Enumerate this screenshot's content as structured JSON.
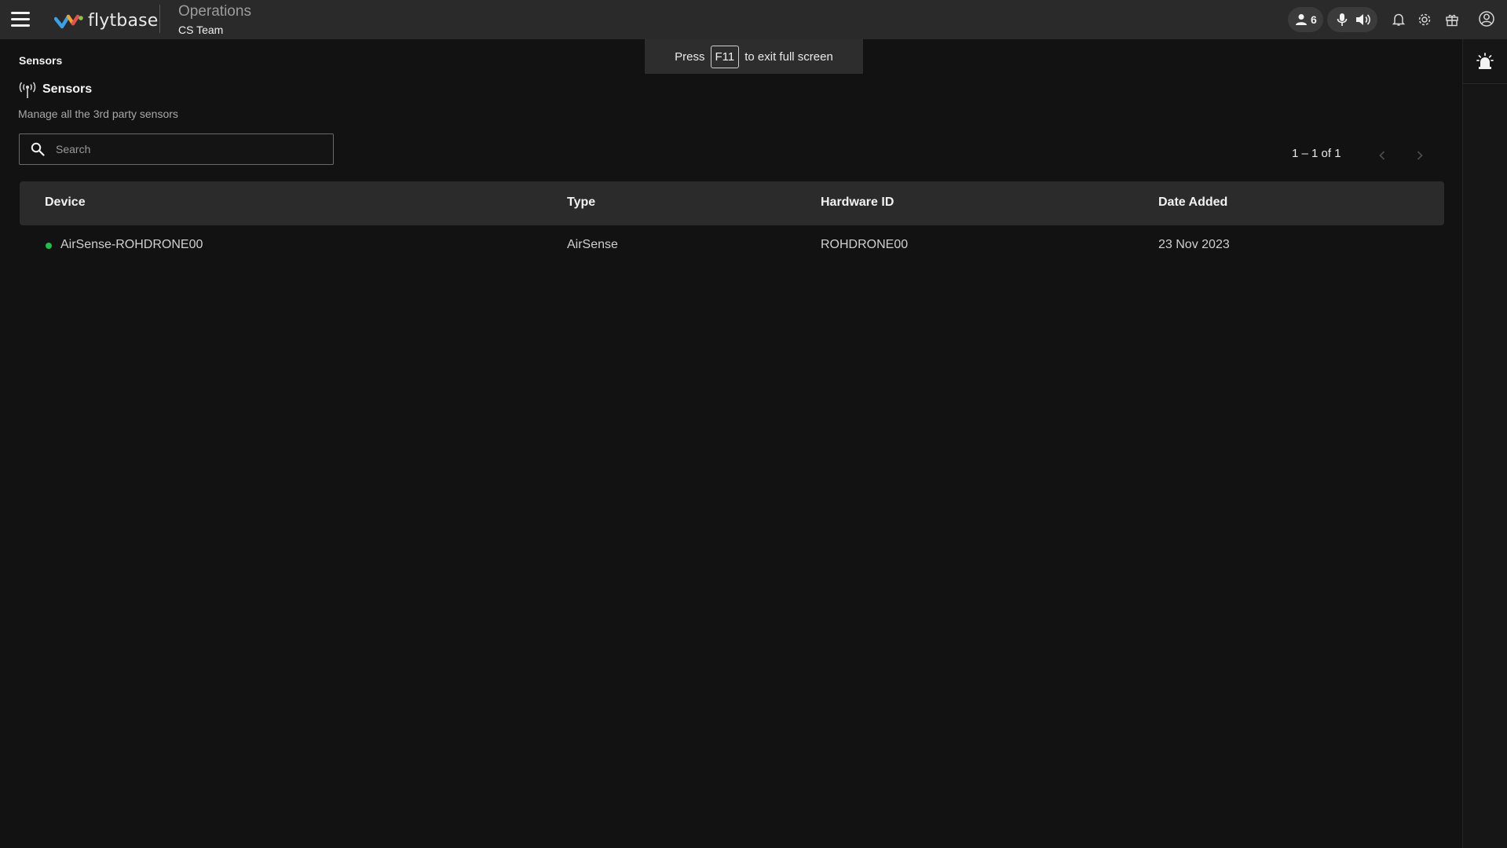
{
  "app": {
    "logo_text": "flytbase",
    "workspace_title": "Operations",
    "workspace_team": "CS Team"
  },
  "topbar": {
    "users_count": "6",
    "icons": [
      "menu-icon",
      "user-icon",
      "microphone-icon",
      "speaker-icon",
      "bell-icon",
      "gear-icon",
      "gift-icon",
      "account-icon"
    ]
  },
  "toast": {
    "prefix": "Press",
    "key": "F11",
    "suffix": "to exit full screen"
  },
  "rail": {
    "icons": [
      "alarm-icon"
    ]
  },
  "page": {
    "breadcrumb": "Sensors",
    "title": "Sensors",
    "description": "Manage all the 3rd party sensors"
  },
  "search": {
    "placeholder": "Search",
    "value": ""
  },
  "pagination": {
    "range": "1 – 1 of 1"
  },
  "table": {
    "columns": [
      "Device",
      "Type",
      "Hardware ID",
      "Date Added"
    ],
    "rows": [
      {
        "status": "online",
        "status_color": "#1fbf4a",
        "device": "AirSense-ROHDRONE00",
        "type": "AirSense",
        "hardware_id": "ROHDRONE00",
        "date_added": "23 Nov 2023"
      }
    ]
  },
  "colors": {
    "background": "#121212",
    "topbar": "#2a2a2a",
    "table_header": "#2b2b2b",
    "status_online": "#1fbf4a"
  }
}
